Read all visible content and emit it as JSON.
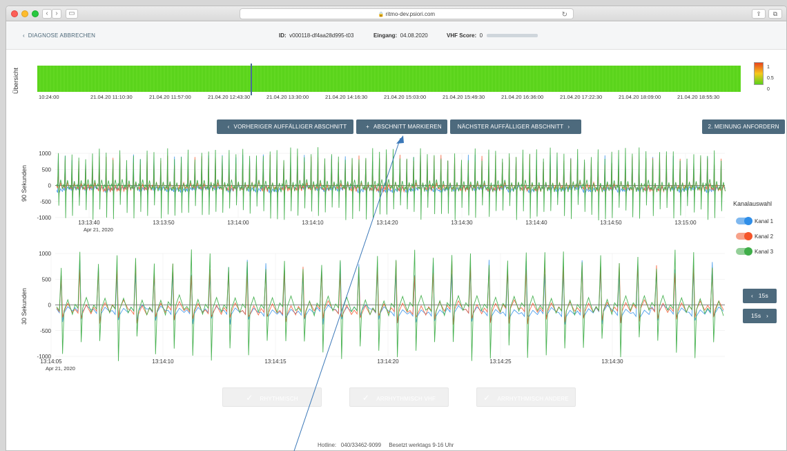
{
  "browser": {
    "url": "ritmo-dev.psiori.com",
    "back_icon": "chevron-left-icon",
    "forward_icon": "chevron-right-icon"
  },
  "header": {
    "cancel_label": "DIAGNOSE ABBRECHEN",
    "id_label": "ID:",
    "id_value": "v000118-df4aa28d995-t03",
    "eingang_label": "Eingang:",
    "eingang_value": "04.08.2020",
    "vhf_label": "VHF Score:",
    "vhf_value": "0"
  },
  "overview": {
    "label": "Übersicht",
    "ticks": [
      "10:24:00",
      "21.04.20 11:10:30",
      "21.04.20 11:57:00",
      "21.04.20 12:43:30",
      "21.04.20 13:30:00",
      "21.04.20 14:16:30",
      "21.04.20 15:03:00",
      "21.04.20 15:49:30",
      "21.04.20 16:36:00",
      "21.04.20 17:22:30",
      "21.04.20 18:09:00",
      "21.04.20 18:55:30"
    ],
    "scale_labels": [
      "1",
      "0.5",
      "0"
    ],
    "colors": {
      "high": "#e8441c",
      "mid": "#f7c81d",
      "low": "#59d11a"
    }
  },
  "toolbar": {
    "prev_label": "VORHERIGER AUFFÄLLIGER ABSCHNITT",
    "mark_label": "ABSCHNITT MARKIEREN",
    "next_label": "NÄCHSTER AUFFÄLLIGER ABSCHNITT",
    "second_opinion_label": "2. MEINUNG ANFORDERN"
  },
  "chart90": {
    "label": "90 Sekunden",
    "yticks": [
      "1000",
      "500",
      "0",
      "-500",
      "-1000"
    ],
    "xticks": [
      "13:13:40",
      "13:13:50",
      "13:14:00",
      "13:14:10",
      "13:14:20",
      "13:14:30",
      "13:14:40",
      "13:14:50",
      "13:15:00"
    ],
    "date": "Apr 21, 2020"
  },
  "chart30": {
    "label": "30 Sekunden",
    "yticks": [
      "1000",
      "500",
      "0",
      "-500",
      "-1000"
    ],
    "xticks": [
      "13:14:05",
      "13:14:10",
      "13:14:15",
      "13:14:20",
      "13:14:25",
      "13:14:30"
    ],
    "date": "Apr 21, 2020"
  },
  "channels": {
    "title": "Kanalauswahl",
    "items": [
      {
        "label": "Kanal 1",
        "color": "#2f8ee8",
        "track": "#7fb8ef"
      },
      {
        "label": "Kanal 2",
        "color": "#f5552a",
        "track": "#f7a28a"
      },
      {
        "label": "Kanal 3",
        "color": "#3fae49",
        "track": "#94cf98"
      }
    ]
  },
  "nav15": {
    "back_label": "15s",
    "forward_label": "15s"
  },
  "diagnosis": {
    "rhythmisch": "RHYTHMISCH",
    "arrhythmisch_vhf": "ARRHYTHMISCH VHF",
    "arrhythmisch_andere": "ARRHYTHMISCH ANDERE"
  },
  "footer": {
    "hotline_label": "Hotline:",
    "hotline_value": "040/33462-9099",
    "hours": "Besetzt werktags 9-16 Uhr"
  }
}
